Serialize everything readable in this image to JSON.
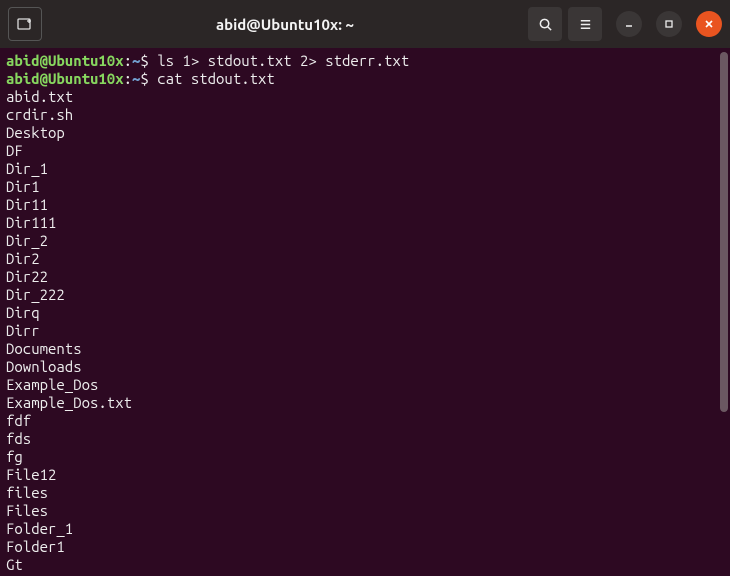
{
  "titlebar": {
    "title": "abid@Ubuntu10x: ~"
  },
  "prompt": {
    "user_host": "abid@Ubuntu10x",
    "separator": ":",
    "path": "~",
    "symbol": "$"
  },
  "commands": [
    "ls 1> stdout.txt 2> stderr.txt",
    "cat stdout.txt"
  ],
  "output_lines": [
    "abid.txt",
    "crdir.sh",
    "Desktop",
    "DF",
    "Dir_1",
    "Dir1",
    "Dir11",
    "Dir111",
    "Dir_2",
    "Dir2",
    "Dir22",
    "Dir_222",
    "Dirq",
    "Dirr",
    "Documents",
    "Downloads",
    "Example_Dos",
    "Example_Dos.txt",
    "fdf",
    "fds",
    "fg",
    "File12",
    "files",
    "Files",
    "Folder_1",
    "Folder1",
    "Gt"
  ]
}
